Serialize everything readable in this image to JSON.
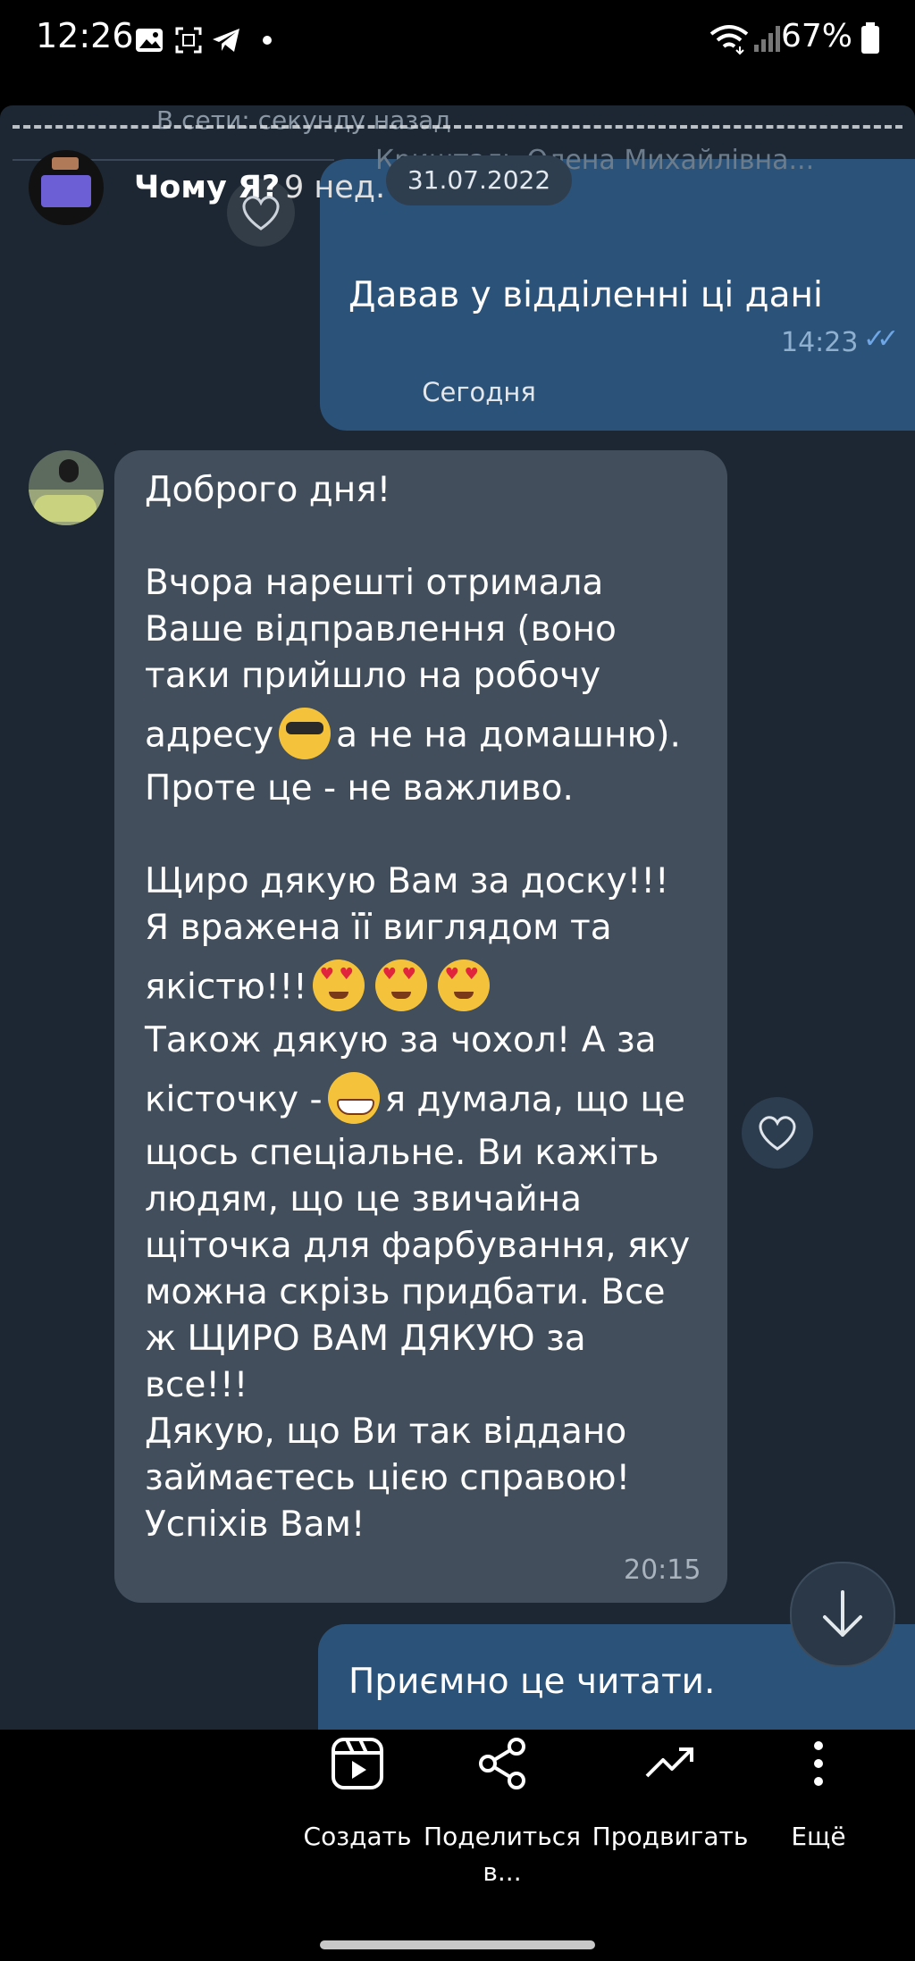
{
  "status_bar": {
    "time": "12:26",
    "battery": "67%",
    "icons": [
      "gallery-icon",
      "screenshot-icon",
      "telegram-icon",
      "dot-icon",
      "wifi-icon",
      "signal-icon",
      "battery-icon"
    ]
  },
  "chat": {
    "online_status": "В сети: секунду назад",
    "date_pill": "31.07.2022",
    "ghost_sender": "Кришталь Олена Михайлівна...",
    "today_label": "Сегодня",
    "messages": [
      {
        "direction": "out",
        "text": "Давав у відділенні ці дані",
        "time": "14:23"
      },
      {
        "direction": "in",
        "lines": [
          "Доброго дня!",
          "Вчора нарешті отримала",
          "Ваше відправлення (воно",
          "таки прийшло на робочу",
          "адресу",
          "а не на домашню).",
          "Проте це - не важливо.",
          "Щиро дякую Вам за доску!!!",
          "Я вражена її виглядом та",
          "якістю!!!",
          "Також дякую за чохол! А за",
          "кісточку -",
          "я думала, що це",
          "щось спеціальне. Ви кажіть",
          "людям, що це звичайна",
          "щіточка для фарбування, яку",
          "можна скрізь придбати. Все",
          "ж ЩИРО ВАМ ДЯКУЮ за",
          "все!!!",
          "Дякую, що Ви так віддано",
          "займаєтесь цією справою!",
          "Успіхів Вам!"
        ],
        "time": "20:15"
      },
      {
        "direction": "out",
        "text": "Приємно це читати."
      }
    ]
  },
  "reel": {
    "title": "Чому Я?",
    "age": "9 нед."
  },
  "actions": [
    {
      "label": "Создать",
      "icon": "reel-create-icon"
    },
    {
      "label": "Поделиться в...",
      "icon": "share-icon"
    },
    {
      "label": "Продвигать",
      "icon": "trending-icon"
    },
    {
      "label": "Ещё",
      "icon": "more-vertical-icon"
    }
  ],
  "colors": {
    "chat_bg": "#1c2733",
    "bubble_in": "#424e5c",
    "bubble_out": "#2b5278",
    "read_checks": "#6fa6e6"
  }
}
